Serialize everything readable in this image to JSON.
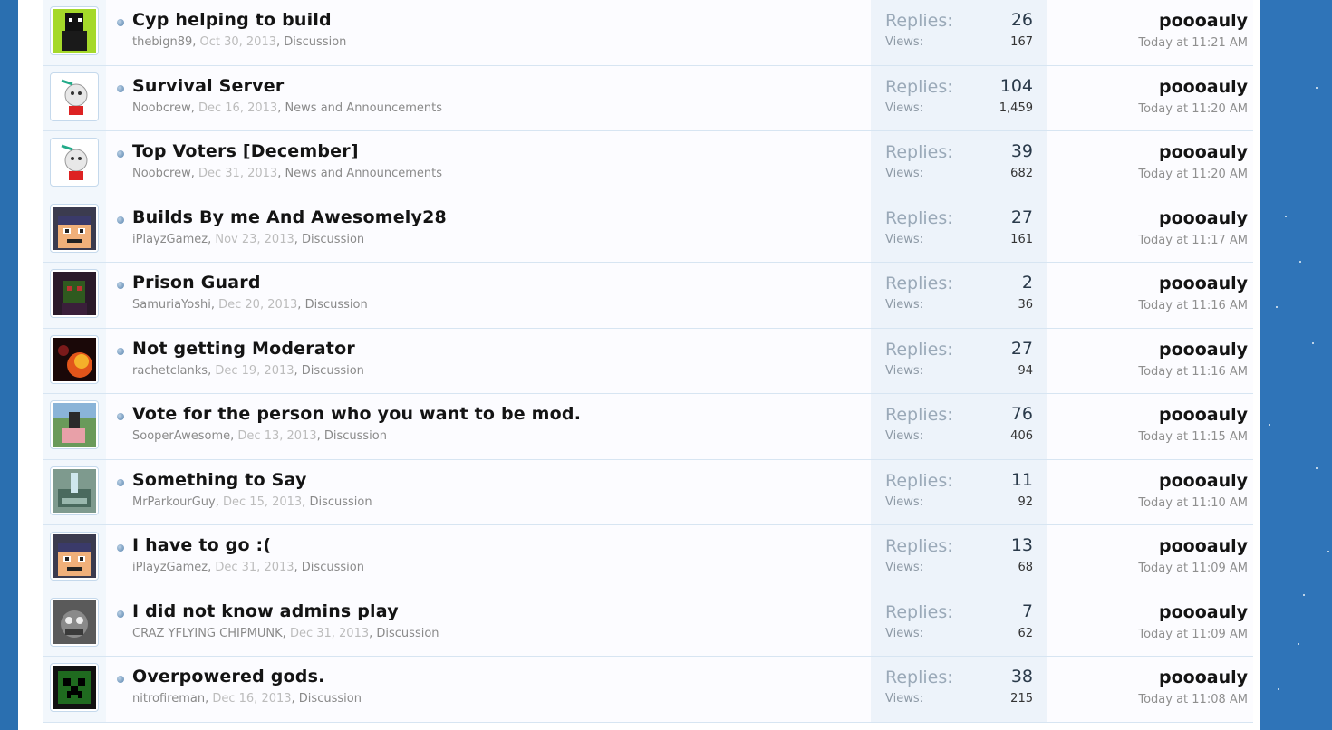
{
  "threads": [
    {
      "title": "Cyp helping to build",
      "author": "thebign89",
      "date": "Oct 30, 2013",
      "forum": "Discussion",
      "replies_label": "Replies:",
      "replies": "26",
      "views_label": "Views:",
      "views": "167",
      "last_user": "poooauly",
      "last_time": "Today at 11:21 AM",
      "avatar": "avatar-green-skin"
    },
    {
      "title": "Survival Server",
      "author": "Noobcrew",
      "date": "Dec 16, 2013",
      "forum": "News and Announcements",
      "replies_label": "Replies:",
      "replies": "104",
      "views_label": "Views:",
      "views": "1,459",
      "last_user": "poooauly",
      "last_time": "Today at 11:20 AM",
      "avatar": "avatar-sheep"
    },
    {
      "title": "Top Voters [December]",
      "author": "Noobcrew",
      "date": "Dec 31, 2013",
      "forum": "News and Announcements",
      "replies_label": "Replies:",
      "replies": "39",
      "views_label": "Views:",
      "views": "682",
      "last_user": "poooauly",
      "last_time": "Today at 11:20 AM",
      "avatar": "avatar-sheep"
    },
    {
      "title": "Builds By me And Awesomely28",
      "author": "iPlayzGamez",
      "date": "Nov 23, 2013",
      "forum": "Discussion",
      "replies_label": "Replies:",
      "replies": "27",
      "views_label": "Views:",
      "views": "161",
      "last_user": "poooauly",
      "last_time": "Today at 11:17 AM",
      "avatar": "avatar-pixel-face"
    },
    {
      "title": "Prison Guard",
      "author": "SamuriaYoshi",
      "date": "Dec 20, 2013",
      "forum": "Discussion",
      "replies_label": "Replies:",
      "replies": "2",
      "views_label": "Views:",
      "views": "36",
      "last_user": "poooauly",
      "last_time": "Today at 11:16 AM",
      "avatar": "avatar-dark-green"
    },
    {
      "title": "Not getting Moderator",
      "author": "rachetclanks",
      "date": "Dec 19, 2013",
      "forum": "Discussion",
      "replies_label": "Replies:",
      "replies": "27",
      "views_label": "Views:",
      "views": "94",
      "last_user": "poooauly",
      "last_time": "Today at 11:16 AM",
      "avatar": "avatar-fire"
    },
    {
      "title": "Vote for the person who you want to be mod.",
      "author": "SooperAwesome",
      "date": "Dec 13, 2013",
      "forum": "Discussion",
      "replies_label": "Replies:",
      "replies": "76",
      "views_label": "Views:",
      "views": "406",
      "last_user": "poooauly",
      "last_time": "Today at 11:15 AM",
      "avatar": "avatar-pig-rider"
    },
    {
      "title": "Something to Say",
      "author": "MrParkourGuy",
      "date": "Dec 15, 2013",
      "forum": "Discussion",
      "replies_label": "Replies:",
      "replies": "11",
      "views_label": "Views:",
      "views": "92",
      "last_user": "poooauly",
      "last_time": "Today at 11:10 AM",
      "avatar": "avatar-beacon"
    },
    {
      "title": "I have to go :(",
      "author": "iPlayzGamez",
      "date": "Dec 31, 2013",
      "forum": "Discussion",
      "replies_label": "Replies:",
      "replies": "13",
      "views_label": "Views:",
      "views": "68",
      "last_user": "poooauly",
      "last_time": "Today at 11:09 AM",
      "avatar": "avatar-pixel-face"
    },
    {
      "title": "I did not know admins play",
      "author": "CRAZ YFLYING CHIPMUNK",
      "date": "Dec 31, 2013",
      "forum": "Discussion",
      "replies_label": "Replies:",
      "replies": "7",
      "views_label": "Views:",
      "views": "62",
      "last_user": "poooauly",
      "last_time": "Today at 11:09 AM",
      "avatar": "avatar-chipmunk"
    },
    {
      "title": "Overpowered gods.",
      "author": "nitrofireman",
      "date": "Dec 16, 2013",
      "forum": "Discussion",
      "replies_label": "Replies:",
      "replies": "38",
      "views_label": "Views:",
      "views": "215",
      "last_user": "poooauly",
      "last_time": "Today at 11:08 AM",
      "avatar": "avatar-creeper"
    }
  ]
}
